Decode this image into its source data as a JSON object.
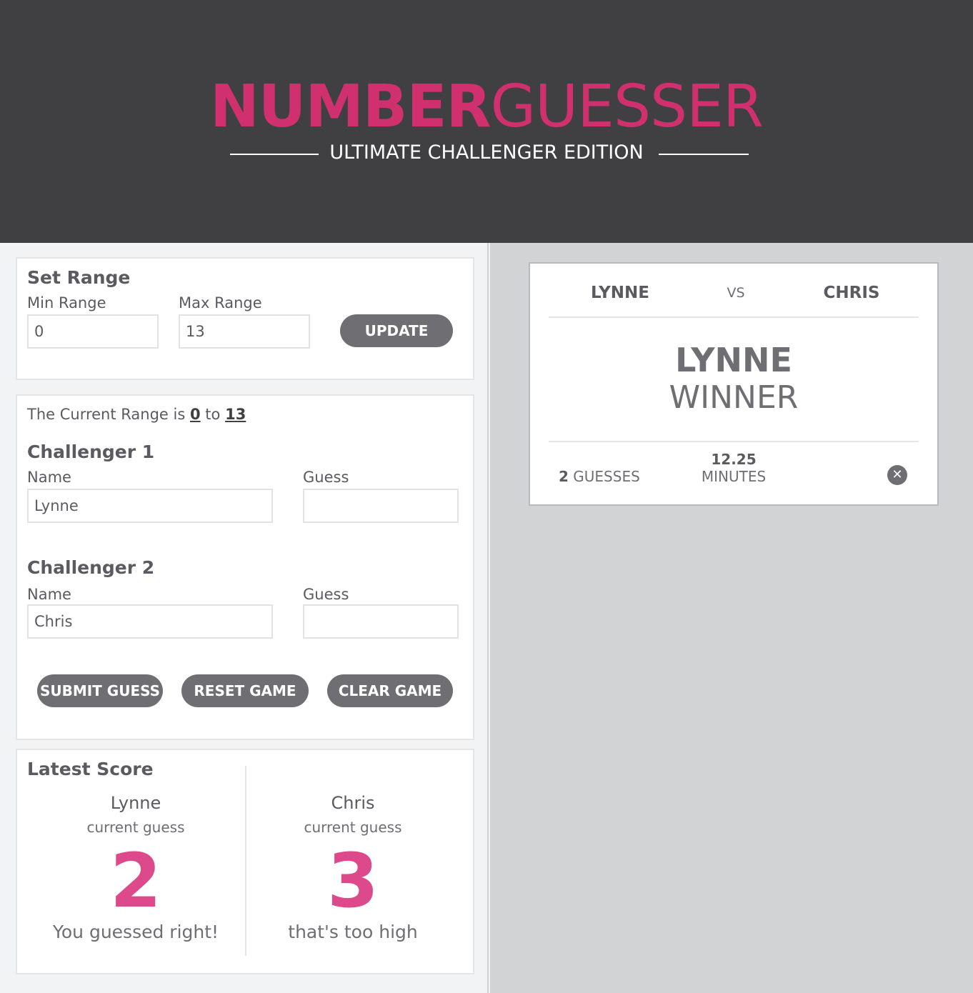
{
  "header": {
    "title_bold": "NUMBER",
    "title_light": "GUESSER",
    "subtitle": "ULTIMATE CHALLENGER EDITION"
  },
  "set_range": {
    "title": "Set Range",
    "min_label": "Min Range",
    "min_value": "0",
    "max_label": "Max Range",
    "max_value": "13",
    "update_label": "UPDATE"
  },
  "challenge": {
    "range_prefix": "The Current Range is",
    "range_min": "0",
    "range_to": "to",
    "range_max": "13",
    "challenger1": {
      "title": "Challenger 1",
      "name_label": "Name",
      "name_value": "Lynne",
      "guess_label": "Guess",
      "guess_value": ""
    },
    "challenger2": {
      "title": "Challenger 2",
      "name_label": "Name",
      "name_value": "Chris",
      "guess_label": "Guess",
      "guess_value": ""
    },
    "submit_label": "SUBMIT GUESS",
    "reset_label": "RESET GAME",
    "clear_label": "CLEAR GAME"
  },
  "latest_score": {
    "title": "Latest Score",
    "player1": {
      "name": "Lynne",
      "sub": "current guess",
      "guess": "2",
      "message": "You guessed right!"
    },
    "player2": {
      "name": "Chris",
      "sub": "current guess",
      "guess": "3",
      "message": "that's too high"
    }
  },
  "winner_card": {
    "player1": "LYNNE",
    "vs": "VS",
    "player2": "CHRIS",
    "winner_name": "LYNNE",
    "winner_label": "WINNER",
    "guess_count": "2",
    "guess_label": "GUESSES",
    "time": "12.25",
    "time_label": "MINUTES",
    "close_icon": "close-circle-icon"
  },
  "colors": {
    "accent": "#d1306f",
    "header_bg": "#404043",
    "button_bg": "#6e6e73"
  }
}
